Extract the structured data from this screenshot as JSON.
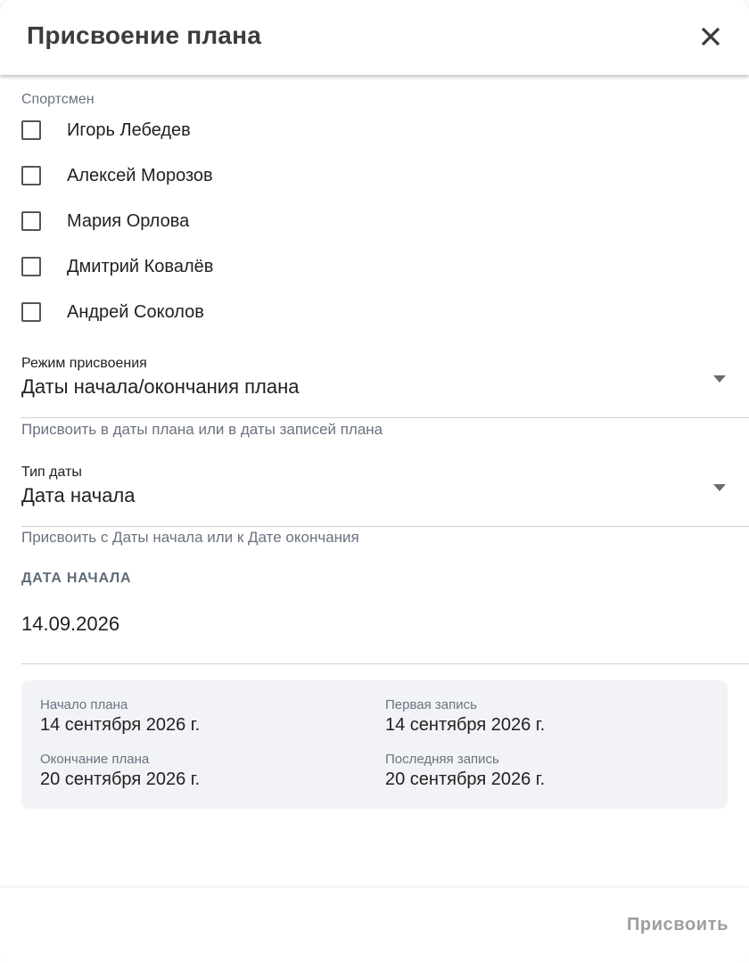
{
  "dialog": {
    "title": "Присвоение плана",
    "close_icon": "close-icon"
  },
  "athletes": {
    "label": "Спортсмен",
    "items": [
      {
        "name": "Игорь Лебедев",
        "checked": false
      },
      {
        "name": "Алексей Морозов",
        "checked": false
      },
      {
        "name": "Мария Орлова",
        "checked": false
      },
      {
        "name": "Дмитрий Ковалёв",
        "checked": false
      },
      {
        "name": "Андрей Соколов",
        "checked": false
      }
    ]
  },
  "assign_mode": {
    "label": "Режим присвоения",
    "value": "Даты начала/окончания плана",
    "helper": "Присвоить в даты плана или в даты записей плана"
  },
  "date_type": {
    "label": "Тип даты",
    "value": "Дата начала",
    "helper": "Присвоить с Даты начала или к Дате окончания"
  },
  "start_date": {
    "label": "ДАТА НАЧАЛА",
    "value": "14.09.2026"
  },
  "summary": {
    "plan_start_label": "Начало плана",
    "plan_start_value": "14 сентября 2026 г.",
    "first_entry_label": "Первая запись",
    "first_entry_value": "14 сентября 2026 г.",
    "plan_end_label": "Окончание плана",
    "plan_end_value": "20 сентября 2026 г.",
    "last_entry_label": "Последняя запись",
    "last_entry_value": "20 сентября 2026 г."
  },
  "footer": {
    "assign_label": "Присвоить"
  },
  "colors": {
    "muted_text": "#6b7280",
    "disabled_button": "#9e9e9e",
    "summary_bg": "#f1f3f6"
  }
}
